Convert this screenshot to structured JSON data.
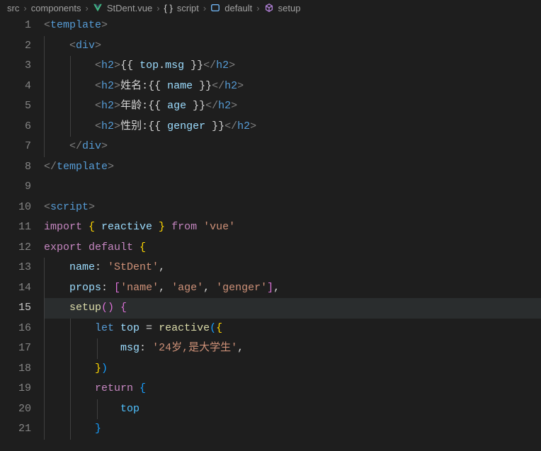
{
  "breadcrumb": {
    "items": [
      "src",
      "components",
      "StDent.vue",
      "script",
      "default",
      "setup"
    ],
    "icons": [
      "",
      "",
      "vue",
      "braces",
      "symbol",
      "cube"
    ]
  },
  "code": {
    "l1": {
      "a": "<",
      "b": "template",
      "c": ">"
    },
    "l2": {
      "a": "<",
      "b": "div",
      "c": ">"
    },
    "l3": {
      "a": "<",
      "b": "h2",
      "c": ">",
      "d": "{{",
      "e": " top",
      "f": ".",
      "g": "msg ",
      "h": "}}",
      "i": "</",
      "j": "h2",
      "k": ">"
    },
    "l4": {
      "a": "<",
      "b": "h2",
      "c": ">",
      "txt": "姓名:",
      "d": "{{",
      "e": " name ",
      "h": "}}",
      "i": "</",
      "j": "h2",
      "k": ">"
    },
    "l5": {
      "a": "<",
      "b": "h2",
      "c": ">",
      "txt": "年龄:",
      "d": "{{",
      "e": " age ",
      "h": "}}",
      "i": "</",
      "j": "h2",
      "k": ">"
    },
    "l6": {
      "a": "<",
      "b": "h2",
      "c": ">",
      "txt": "性别:",
      "d": "{{",
      "e": " genger ",
      "h": "}}",
      "i": "</",
      "j": "h2",
      "k": ">"
    },
    "l7": {
      "a": "</",
      "b": "div",
      "c": ">"
    },
    "l8": {
      "a": "</",
      "b": "template",
      "c": ">"
    },
    "l10": {
      "a": "<",
      "b": "script",
      "c": ">"
    },
    "l11": {
      "a": "import ",
      "b": "{ ",
      "c": "reactive ",
      "d": "} ",
      "e": "from ",
      "f": "'vue'"
    },
    "l12": {
      "a": "export ",
      "b": "default ",
      "c": "{"
    },
    "l13": {
      "a": "name",
      "b": ": ",
      "c": "'StDent'",
      "d": ","
    },
    "l14": {
      "a": "props",
      "b": ": ",
      "c": "[",
      "d": "'name'",
      "e": ", ",
      "f": "'age'",
      "g": ", ",
      "h": "'genger'",
      "i": "]",
      "j": ","
    },
    "l15": {
      "a": "setup",
      "b": "() ",
      "c": "{"
    },
    "l16": {
      "a": "let ",
      "b": "top ",
      "c": "= ",
      "d": "reactive",
      "e": "(",
      "f": "{"
    },
    "l17": {
      "a": "msg",
      "b": ": ",
      "c": "'24岁,是大学生'",
      "d": ","
    },
    "l18": {
      "a": "}",
      "b": ")"
    },
    "l19": {
      "a": "return ",
      "b": "{"
    },
    "l20": {
      "a": "top"
    },
    "l21": {
      "a": "}"
    }
  },
  "lineNumbers": [
    "1",
    "2",
    "3",
    "4",
    "5",
    "6",
    "7",
    "8",
    "9",
    "10",
    "11",
    "12",
    "13",
    "14",
    "15",
    "16",
    "17",
    "18",
    "19",
    "20",
    "21"
  ]
}
